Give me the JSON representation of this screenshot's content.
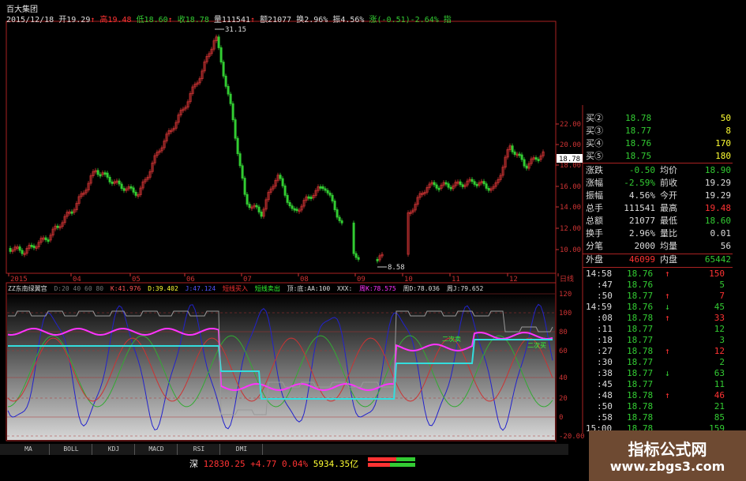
{
  "header": {
    "stock_name": "百大集团",
    "date": "2015/12/18",
    "open": "开19.29",
    "high": "高19.48",
    "low": "低18.60",
    "close": "收18.78",
    "volume": "量111541",
    "amount": "额21077",
    "turnover": "换2.96%",
    "amplitude": "振4.56%",
    "change": "涨(-0.51)-2.64%",
    "extra": "指"
  },
  "price_labels": {
    "peak": "31.15",
    "trough": "8.58",
    "current": "18.78"
  },
  "price_axis": [
    "22.00",
    "20.00",
    "18.00",
    "16.00",
    "14.00",
    "12.00",
    "10.00"
  ],
  "time_axis": [
    "2015",
    "04",
    "05",
    "06",
    "07",
    "08",
    "09",
    "10",
    "11",
    "12",
    "日线"
  ],
  "indicator": {
    "title": "ZZ东南绿翼宫",
    "params": "D:20 40 60 80",
    "v1": "K:41.976",
    "v2": "D:39.402",
    "v3": "J:47.124",
    "buy": "短线买入",
    "sell": "短线卖出",
    "topbottom": "顶:底:AA:100",
    "xxx": "XXX:",
    "week": "周K:78.575",
    "weekd": "周D:78.036",
    "weekj": "周J:79.652",
    "axis": [
      "120",
      "100",
      "80",
      "60",
      "40",
      "20",
      "0",
      "-20.00"
    ],
    "label_sell": "二次卖",
    "label_buy": "二次买"
  },
  "tabs": [
    "MA",
    "BOLL",
    "KDJ",
    "MACD",
    "RSI",
    "DMI"
  ],
  "quote": {
    "buy_levels": [
      {
        "label": "买②",
        "price": "18.78",
        "vol": "50"
      },
      {
        "label": "买③",
        "price": "18.77",
        "vol": "8"
      },
      {
        "label": "买④",
        "price": "18.76",
        "vol": "170"
      },
      {
        "label": "买⑤",
        "price": "18.75",
        "vol": "180"
      }
    ],
    "stats": [
      {
        "l1": "涨跌",
        "v1": "-0.50",
        "l2": "均价",
        "v2": "18.90"
      },
      {
        "l1": "涨幅",
        "v1": "-2.59%",
        "l2": "前收",
        "v2": "19.29"
      },
      {
        "l1": "振幅",
        "v1": "4.56%",
        "l2": "今开",
        "v2": "19.29"
      },
      {
        "l1": "总手",
        "v1": "111541",
        "l2": "最高",
        "v2": "19.48"
      },
      {
        "l1": "总额",
        "v1": "21077",
        "l2": "最低",
        "v2": "18.60"
      },
      {
        "l1": "换手",
        "v1": "2.96%",
        "l2": "量比",
        "v2": "0.01"
      },
      {
        "l1": "分笔",
        "v1": "2000",
        "l2": "均量",
        "v2": "56"
      }
    ],
    "outer_label": "外盘",
    "outer": "46099",
    "inner_label": "内盘",
    "inner": "65442"
  },
  "ticks": [
    {
      "time": "14:58",
      "price": "18.76",
      "dir": "up",
      "vol": "150"
    },
    {
      "time": ":47",
      "price": "18.76",
      "dir": "",
      "vol": "5"
    },
    {
      "time": ":50",
      "price": "18.77",
      "dir": "up",
      "vol": "7"
    },
    {
      "time": "14:59",
      "price": "18.76",
      "dir": "down",
      "vol": "45"
    },
    {
      "time": ":08",
      "price": "18.78",
      "dir": "up",
      "vol": "33"
    },
    {
      "time": ":11",
      "price": "18.77",
      "dir": "",
      "vol": "12"
    },
    {
      "time": ":18",
      "price": "18.77",
      "dir": "",
      "vol": "3"
    },
    {
      "time": ":27",
      "price": "18.78",
      "dir": "up",
      "vol": "12"
    },
    {
      "time": ":30",
      "price": "18.77",
      "dir": "",
      "vol": "2"
    },
    {
      "time": ":38",
      "price": "18.77",
      "dir": "down",
      "vol": "63"
    },
    {
      "time": ":45",
      "price": "18.77",
      "dir": "",
      "vol": "11"
    },
    {
      "time": ":48",
      "price": "18.78",
      "dir": "up",
      "vol": "46"
    },
    {
      "time": ":50",
      "price": "18.78",
      "dir": "",
      "vol": "21"
    },
    {
      "time": ":58",
      "price": "18.78",
      "dir": "",
      "vol": "85"
    },
    {
      "time": "15:00",
      "price": "18.78",
      "dir": "",
      "vol": "159"
    }
  ],
  "status_bar": {
    "index_name": "深",
    "index_value": "12830.25",
    "change": "+4.77",
    "pct": "0.04%",
    "amount": "5934.35亿"
  },
  "watermark": {
    "line1": "指标公式网",
    "line2": "www.zbgs3.com"
  },
  "colors": {
    "up": "#ff3333",
    "down": "#33cc33",
    "yellow": "#ffff33",
    "cyan": "#33dddd",
    "magenta": "#ff33ff",
    "axis": "#cc3333"
  }
}
